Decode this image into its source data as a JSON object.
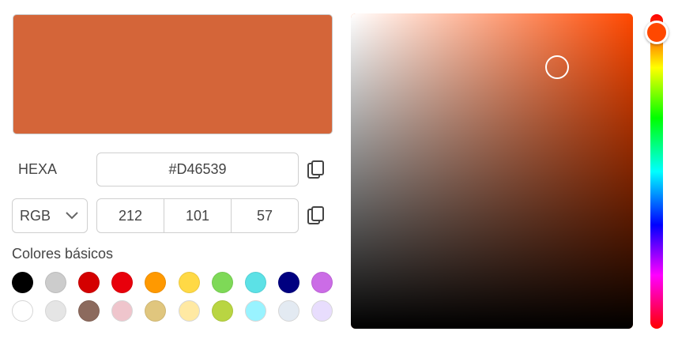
{
  "color": {
    "hex": "#D46539",
    "r": "212",
    "g": "101",
    "b": "57",
    "hue_hex": "#FF4800",
    "saturation": 0.73,
    "value": 0.83,
    "hue_degrees": 17
  },
  "hexa_label": "HEXA",
  "mode": {
    "selected": "RGB"
  },
  "basic_colors": {
    "title": "Colores básicos",
    "row1": [
      "#000000",
      "#CCCCCC",
      "#D40000",
      "#E8000B",
      "#FF9900",
      "#FFD945",
      "#7ED957",
      "#5CE1E6",
      "#000080",
      "#CB6CE6"
    ],
    "row2": [
      "#FFFFFF",
      "#E5E5E5",
      "#8C6A5D",
      "#EFC5CC",
      "#E0C67E",
      "#FFE9A3",
      "#B9D542",
      "#99F3FF",
      "#E3EAF2",
      "#E8DDFD"
    ]
  },
  "icons": {
    "copy_hex": "copy-icon",
    "copy_rgb": "copy-icon",
    "dropdown": "chevron-down-icon"
  }
}
